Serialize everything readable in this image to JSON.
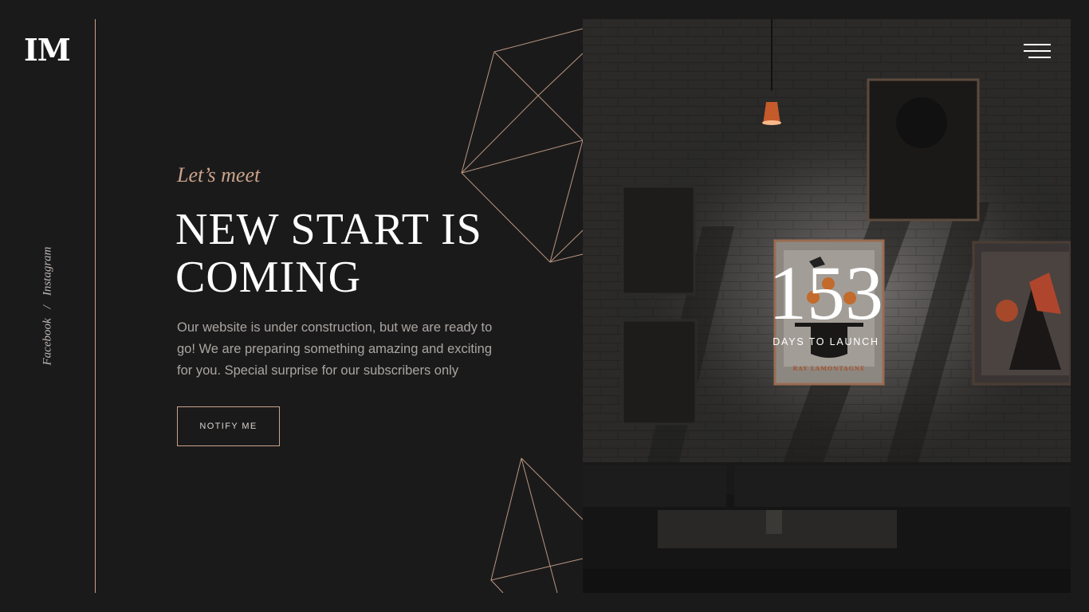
{
  "brand": {
    "logo_text": "IM"
  },
  "social": {
    "items": [
      "Facebook",
      "Instagram"
    ],
    "separator": "/"
  },
  "hero": {
    "kicker": "Let’s meet",
    "title": "NEW START IS COMING",
    "description": "Our website is under construction, but we are ready to go! We are preparing something amazing and exciting for you. Special surprise for our subscribers only",
    "cta_label": "NOTIFY ME"
  },
  "countdown": {
    "value": "153",
    "label": "DAYS TO LAUNCH"
  },
  "poster": {
    "text": "RAY LAMONTAGNE"
  },
  "colors": {
    "background": "#1b1a1b",
    "accent": "#c9a38a",
    "text": "#ffffff",
    "muted": "#a9a5a1"
  },
  "icons": {
    "menu": "hamburger-menu-icon"
  }
}
